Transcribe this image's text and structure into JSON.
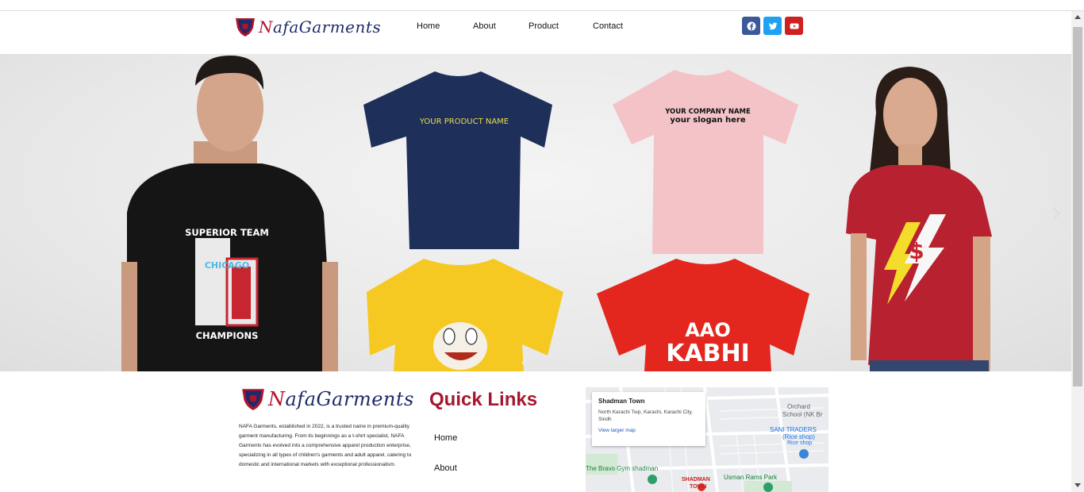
{
  "brand": {
    "first_letter": "N",
    "rest": "afaGarments"
  },
  "nav": {
    "home": "Home",
    "about": "About",
    "product": "Product",
    "contact": "Contact"
  },
  "socials": [
    {
      "icon": "facebook-icon",
      "color": "#3b5998"
    },
    {
      "icon": "twitter-icon",
      "color": "#1da1f2"
    },
    {
      "icon": "youtube-icon",
      "color": "#cd201f"
    }
  ],
  "hero": {
    "shirts": {
      "navy": "YOUR PRODUCT NAME",
      "pink_line1": "YOUR COMPANY NAME",
      "pink_line2": "your slogan here",
      "black_top": "SUPERIOR TEAM",
      "black_mid": "CHICAGO",
      "black_bottom": "CHAMPIONS",
      "red_line1": "AAO",
      "red_line2": "KABHI",
      "woman_symbol": "$"
    }
  },
  "footer": {
    "about": "NAFA Garments, established in 2022, is a trusted name in premium-quality garment manufacturing. From its beginnings as a t-shirt specialist, NAFA Garments has evolved into a comprehensive apparel production enterprise, specializing in all types of children's garments and adult apparel, catering to domestic and international markets with exceptional professionalism.",
    "quick_links_title": "Quick Links",
    "quick_links": [
      "Home",
      "About"
    ],
    "map": {
      "place": "Shadman Town",
      "address": "North Karachi Twp, Karachi, Karachi City, Sindh",
      "link": "View larger map",
      "labels": {
        "orchard": "Orchard",
        "school": "School (NK Br",
        "sani": "SANI TRADERS",
        "rice": "(Rice shop)",
        "rice2": "Rice shop",
        "bravo": "The Bravo Gym shadman",
        "shadman1": "SHADMAN",
        "shadman2": "TOWN",
        "usman": "Usman Rams Park"
      }
    }
  }
}
